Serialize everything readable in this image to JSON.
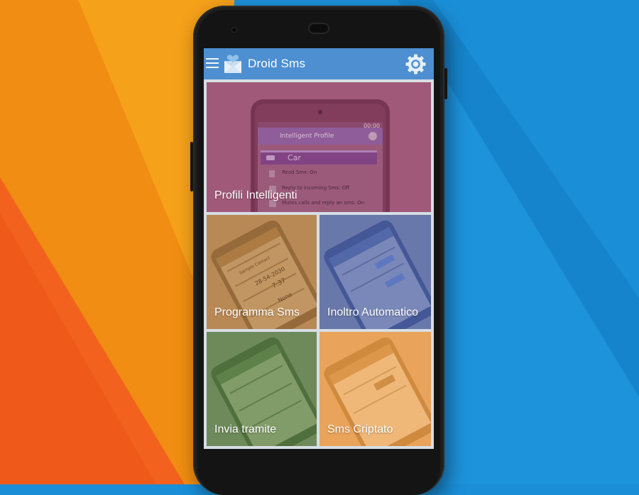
{
  "colors": {
    "appbar": "#4d8fd1",
    "bg_orange": "#f6a11a",
    "bg_red_orange": "#f2621e",
    "bg_blue": "#1a8fd8",
    "tile_profile": "#a25a79",
    "tile_schedule": "#b98a55",
    "tile_forward": "#6a78ab",
    "tile_send_via": "#6f8a5a",
    "tile_encrypted": "#eaa35a"
  },
  "app": {
    "title": "Droid Sms",
    "menu_icon": "hamburger-menu-icon",
    "logo_icon": "envelope-heart-icon",
    "settings_icon": "gear-icon"
  },
  "tiles": [
    {
      "label": "Profili Intelligenti",
      "preview": {
        "clock": "00:00",
        "header": "Intelligent Profile",
        "profile": "Car",
        "rows": [
          "Read Sms: On",
          "Reply to incoming Sms: Off",
          "Mutes calls and reply an sms: On"
        ]
      }
    },
    {
      "label": "Programma Sms",
      "preview": {
        "contact": "Sample Contact",
        "date": "28-54-2030",
        "time": "7:37",
        "repeat": "None"
      }
    },
    {
      "label": "Inoltro Automatico"
    },
    {
      "label": "Invia tramite"
    },
    {
      "label": "Sms Criptato"
    }
  ]
}
